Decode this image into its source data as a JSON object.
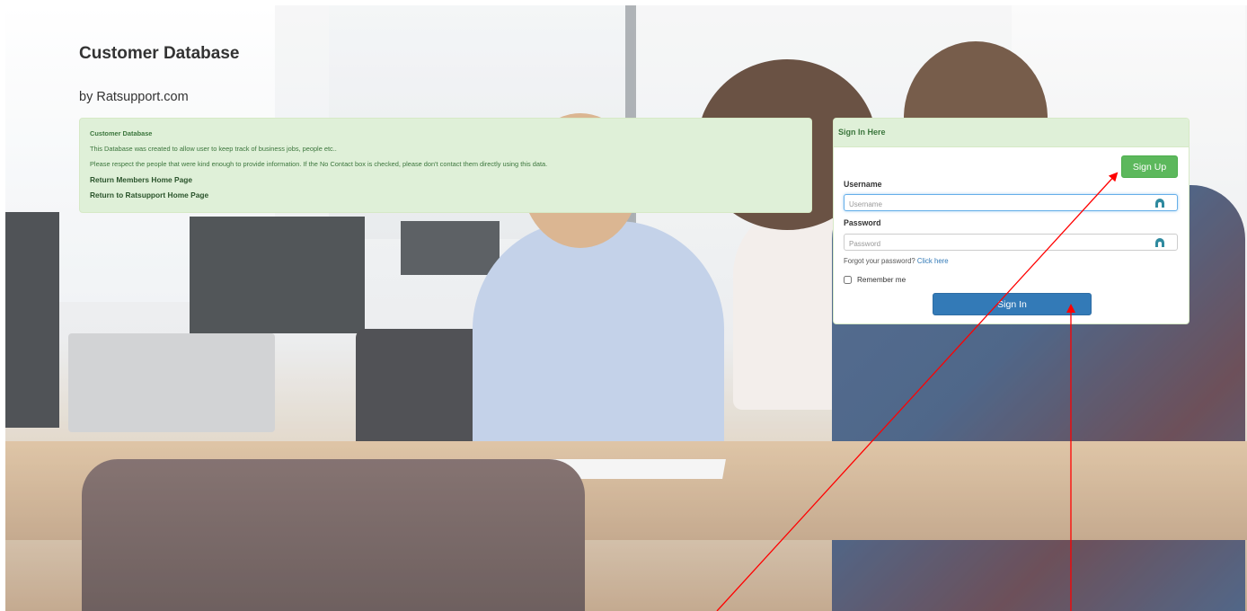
{
  "header": {
    "title": "Customer Database",
    "subtitle": "by Ratsupport.com"
  },
  "info_panel": {
    "title": "Customer Database",
    "lines": [
      "This Database was created to allow user to keep track of business jobs, people etc..",
      "Please respect the people that were kind enough to provide information. If the No Contact box is checked, please don't contact them directly using this data."
    ],
    "links": [
      "Return Members Home Page",
      "Return to Ratsupport Home Page"
    ]
  },
  "login": {
    "heading": "Sign In Here",
    "signup_label": "Sign Up",
    "username_label": "Username",
    "username_placeholder": "Username",
    "password_label": "Password",
    "password_placeholder": "Password",
    "forgot_text": "Forgot your password?",
    "forgot_link": "Click here",
    "remember_label": "Remember me",
    "signin_label": "Sign In"
  },
  "colors": {
    "panel_green_bg": "#dff0d8",
    "panel_green_text": "#3c763d",
    "signup_green": "#5cb85c",
    "signin_blue": "#337ab7",
    "annotation_red": "#ff0000"
  },
  "icons": {
    "password_manager": "password-manager-icon"
  }
}
